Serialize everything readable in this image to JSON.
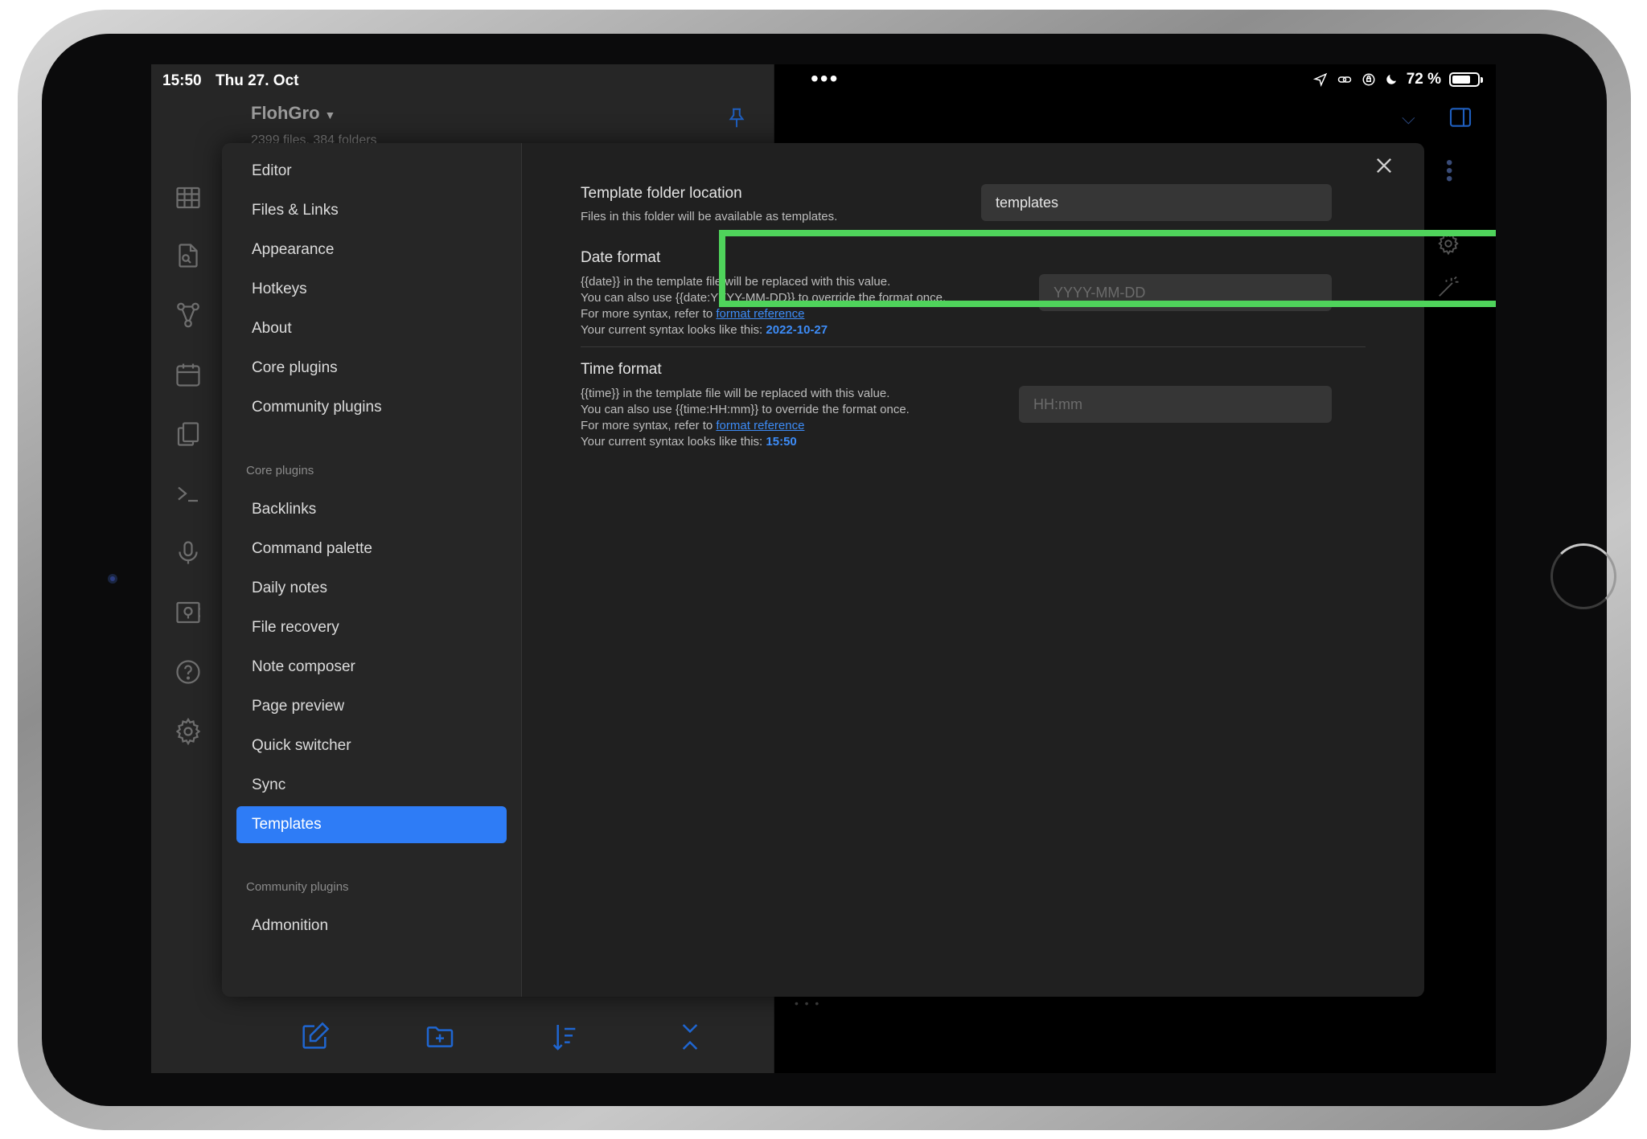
{
  "status": {
    "time": "15:50",
    "date": "Thu 27. Oct",
    "dots": "•••",
    "battery": "72 %",
    "battery_level": 0.72,
    "icons": [
      "location-arrow-icon",
      "link-icon",
      "lock-rotation-icon",
      "do-not-disturb-icon",
      "battery-icon"
    ]
  },
  "vault": {
    "name": "FlohGro",
    "stats": "2399 files, 384 folders"
  },
  "ribbon": {
    "icons": [
      "table-icon",
      "search-file-icon",
      "graph-icon",
      "calendar-icon",
      "copy-icon",
      "terminal-icon",
      "microphone-icon",
      "vault-icon",
      "help-icon",
      "settings-icon"
    ]
  },
  "bottom_toolbar": {
    "icons": [
      "new-note-icon",
      "new-folder-icon",
      "sort-icon",
      "collapse-icon"
    ]
  },
  "settings_nav": {
    "general": [
      "Editor",
      "Files & Links",
      "Appearance",
      "Hotkeys",
      "About",
      "Core plugins",
      "Community plugins"
    ],
    "core_section_label": "Core plugins",
    "core": [
      "Backlinks",
      "Command palette",
      "Daily notes",
      "File recovery",
      "Note composer",
      "Page preview",
      "Quick switcher",
      "Sync",
      "Templates"
    ],
    "community_section_label": "Community plugins",
    "community": [
      "Admonition"
    ],
    "active": "Templates"
  },
  "settings": {
    "template_folder": {
      "name": "Template folder location",
      "desc": "Files in this folder will be available as templates.",
      "value": "templates",
      "highlight_color": "#4fd35b"
    },
    "date_format": {
      "name": "Date format",
      "line1": "{{date}} in the template file will be replaced with this value.",
      "line2": "You can also use {{date:YYYY-MM-DD}} to override the format once.",
      "line3_prefix": "For more syntax, refer to ",
      "link": "format reference",
      "line4_prefix": "Your current syntax looks like this: ",
      "current": "2022-10-27",
      "placeholder": "YYYY-MM-DD"
    },
    "time_format": {
      "name": "Time format",
      "line1": "{{time}} in the template file will be replaced with this value.",
      "line2": "You can also use {{time:HH:mm}} to override the format once.",
      "line3_prefix": "For more syntax, refer to ",
      "link": "format reference",
      "line4_prefix": "Your current syntax looks like this: ",
      "current": "15:50",
      "placeholder": "HH:mm"
    }
  },
  "colors": {
    "accent": "#2e7cf6",
    "link": "#3d8cf7",
    "highlight": "#4fd35b"
  }
}
